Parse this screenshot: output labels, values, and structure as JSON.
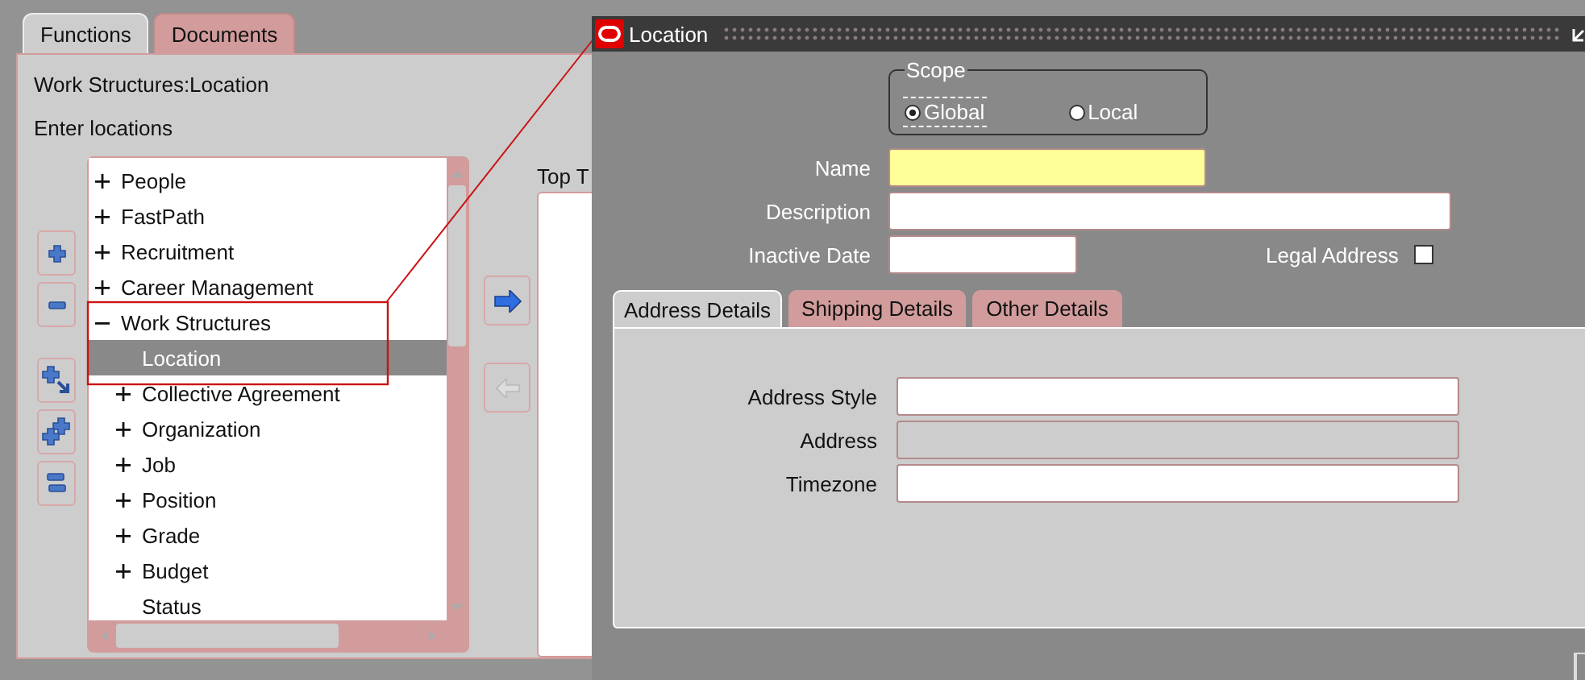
{
  "navigator": {
    "tabs": [
      {
        "label": "Functions",
        "selected": true
      },
      {
        "label": "Documents",
        "selected": false
      }
    ],
    "path": "Work Structures:Location",
    "instruction": "Enter locations",
    "tree": [
      {
        "label": "People",
        "expanded": false,
        "selected": false
      },
      {
        "label": "FastPath",
        "expanded": false,
        "selected": false
      },
      {
        "label": "Recruitment",
        "expanded": false,
        "selected": false
      },
      {
        "label": "Career Management",
        "expanded": false,
        "selected": false
      },
      {
        "label": "Work Structures",
        "expanded": true,
        "selected": false,
        "children": [
          {
            "label": "Location",
            "selected": true
          },
          {
            "label": "Collective Agreement",
            "expanded": false,
            "selected": false
          },
          {
            "label": "Organization",
            "expanded": false,
            "selected": false
          },
          {
            "label": "Job",
            "expanded": false,
            "selected": false
          },
          {
            "label": "Position",
            "expanded": false,
            "selected": false
          },
          {
            "label": "Grade",
            "expanded": false,
            "selected": false
          },
          {
            "label": "Budget",
            "expanded": false,
            "selected": false
          },
          {
            "label": "Status",
            "selected": false
          }
        ]
      }
    ],
    "top_list_label": "Top T"
  },
  "location_window": {
    "title": "Location",
    "scope": {
      "legend": "Scope",
      "options": [
        {
          "label": "Global",
          "selected": true
        },
        {
          "label": "Local",
          "selected": false
        }
      ]
    },
    "fields": [
      {
        "label": "Name",
        "kind": "required"
      },
      {
        "label": "Description",
        "kind": "text"
      },
      {
        "label": "Inactive Date",
        "kind": "date"
      }
    ],
    "legal_address": {
      "label": "Legal Address",
      "checked": false
    },
    "tabs": [
      {
        "label": "Address Details",
        "selected": true
      },
      {
        "label": "Shipping Details",
        "selected": false
      },
      {
        "label": "Other Details",
        "selected": false
      }
    ],
    "address_fields": [
      {
        "label": "Address Style",
        "disabled": false
      },
      {
        "label": "Address",
        "disabled": true
      },
      {
        "label": "Timezone",
        "disabled": false
      }
    ]
  }
}
